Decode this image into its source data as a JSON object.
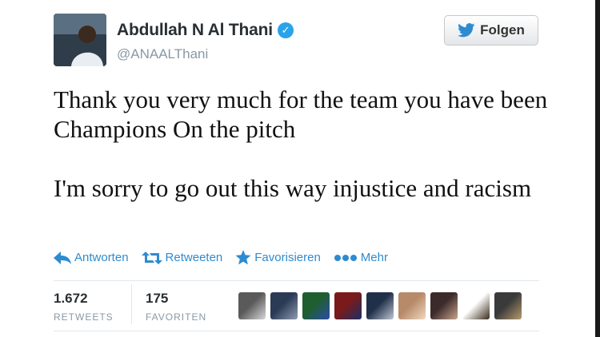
{
  "author": {
    "name": "Abdullah N Al Thani",
    "handle": "@ANAALThani",
    "verified": true
  },
  "follow_button": {
    "label": "Folgen",
    "icon": "twitter-bird-icon"
  },
  "tweet": {
    "paragraphs": [
      "Thank you very much for the team you have been Champions On the pitch",
      "I'm sorry to go out this way injustice and racism"
    ]
  },
  "actions": {
    "reply": "Antworten",
    "retweet": "Retweeten",
    "favorite": "Favorisieren",
    "more": "Mehr"
  },
  "stats": {
    "retweets": {
      "count": "1.672",
      "label": "RETWEETS"
    },
    "favorites": {
      "count": "175",
      "label": "FAVORITEN"
    }
  },
  "favoriters": [
    {
      "colors": [
        "#5a5a5a",
        "#d8d8d8"
      ]
    },
    {
      "colors": [
        "#2b3a55",
        "#8f9bb0"
      ]
    },
    {
      "colors": [
        "#1f5e2e",
        "#2a4da8"
      ]
    },
    {
      "colors": [
        "#7a1a1a",
        "#1b2e66"
      ]
    },
    {
      "colors": [
        "#20304a",
        "#bfc6d4"
      ]
    },
    {
      "colors": [
        "#b78a6a",
        "#f0d8c0"
      ]
    },
    {
      "colors": [
        "#3c2b2b",
        "#c9a58c"
      ]
    },
    {
      "colors": [
        "#ffffff",
        "#3a2a1a"
      ]
    },
    {
      "colors": [
        "#3a3a3a",
        "#b59a6e"
      ]
    }
  ],
  "colors": {
    "accent": "#2e8bd0",
    "verified": "#2ba3e8"
  }
}
